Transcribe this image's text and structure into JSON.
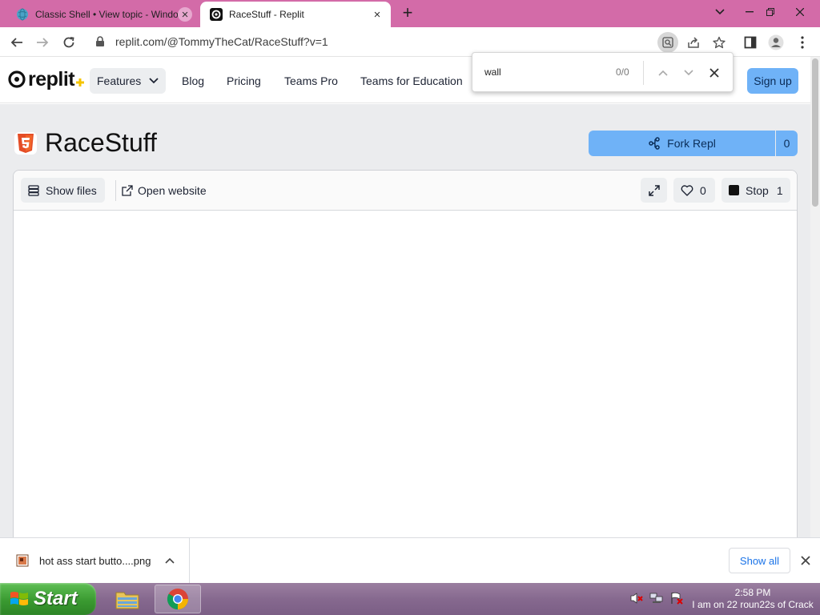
{
  "browser": {
    "tabs": [
      {
        "title": "Classic Shell • View topic - Windo",
        "active": false
      },
      {
        "title": "RaceStuff - Replit",
        "active": true
      }
    ],
    "url": "replit.com/@TommyTheCat/RaceStuff?v=1"
  },
  "find_bar": {
    "query": "wall",
    "count": "0/0"
  },
  "header": {
    "logo_text": "replit",
    "nav": {
      "features": "Features",
      "blog": "Blog",
      "pricing": "Pricing",
      "teams_pro": "Teams Pro",
      "teams_edu": "Teams for Education"
    },
    "signup": "Sign up"
  },
  "repl": {
    "title": "RaceStuff",
    "fork_label": "Fork Repl",
    "fork_count": "0",
    "show_files": "Show files",
    "open_website": "Open website",
    "likes": "0",
    "stop_label": "Stop",
    "stop_count": "1"
  },
  "downloads": {
    "file_name": "hot ass start butto....png",
    "show_all": "Show all"
  },
  "taskbar": {
    "start_label": "Start",
    "time": "2:58 PM",
    "status_text": "I am on 22 roun22s of Crack"
  },
  "colors": {
    "tabstrip": "#d36ba8",
    "accent_blue": "#6fb2f7",
    "start_green": "#3a9a31",
    "taskbar": "#86698f"
  }
}
